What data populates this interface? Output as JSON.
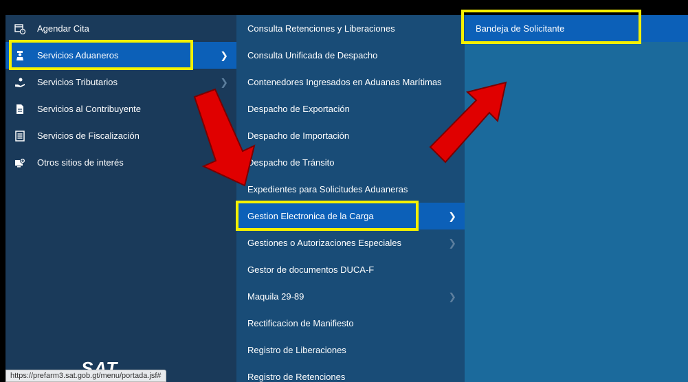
{
  "left_menu": {
    "items": [
      {
        "label": "Agendar Cita",
        "icon": "calendar-clock-icon",
        "selected": false,
        "has_submenu": false
      },
      {
        "label": "Servicios Aduaneros",
        "icon": "customs-officer-icon",
        "selected": true,
        "has_submenu": true
      },
      {
        "label": "Servicios Tributarios",
        "icon": "hand-coins-icon",
        "selected": false,
        "has_submenu": true
      },
      {
        "label": "Servicios al Contribuyente",
        "icon": "document-icon",
        "selected": false,
        "has_submenu": false
      },
      {
        "label": "Servicios de Fiscalización",
        "icon": "checklist-icon",
        "selected": false,
        "has_submenu": false
      },
      {
        "label": "Otros sitios de interés",
        "icon": "add-screen-icon",
        "selected": false,
        "has_submenu": false
      }
    ],
    "logo_text": "SAT",
    "status_url": "https://prefarm3.sat.gob.gt/menu/portada.jsf#"
  },
  "submenu": {
    "items": [
      {
        "label": "Consulta Retenciones y Liberaciones",
        "selected": false,
        "has_submenu": false
      },
      {
        "label": "Consulta Unificada de Despacho",
        "selected": false,
        "has_submenu": false
      },
      {
        "label": "Contenedores Ingresados en Aduanas Marítimas",
        "selected": false,
        "has_submenu": false
      },
      {
        "label": "Despacho de Exportación",
        "selected": false,
        "has_submenu": false
      },
      {
        "label": "Despacho de Importación",
        "selected": false,
        "has_submenu": false
      },
      {
        "label": "Despacho de Tránsito",
        "selected": false,
        "has_submenu": false
      },
      {
        "label": "Expedientes para Solicitudes Aduaneras",
        "selected": false,
        "has_submenu": false
      },
      {
        "label": "Gestion Electronica de la Carga",
        "selected": true,
        "has_submenu": true
      },
      {
        "label": "Gestiones o Autorizaciones Especiales",
        "selected": false,
        "has_submenu": true
      },
      {
        "label": "Gestor de documentos DUCA-F",
        "selected": false,
        "has_submenu": false
      },
      {
        "label": "Maquila 29-89",
        "selected": false,
        "has_submenu": true
      },
      {
        "label": "Rectificacion de Manifiesto",
        "selected": false,
        "has_submenu": false
      },
      {
        "label": "Registro de Liberaciones",
        "selected": false,
        "has_submenu": false
      },
      {
        "label": "Registro de Retenciones",
        "selected": false,
        "has_submenu": false
      }
    ]
  },
  "subsubmenu": {
    "items": [
      {
        "label": "Bandeja de Solicitante",
        "selected": true
      }
    ]
  },
  "colors": {
    "left_bg": "#1a3a5a",
    "mid_bg": "#194c77",
    "right_bg": "#1b6a9c",
    "selected_bg": "#0c60b8",
    "highlight": "#f4f000",
    "arrow": "#e00000"
  }
}
